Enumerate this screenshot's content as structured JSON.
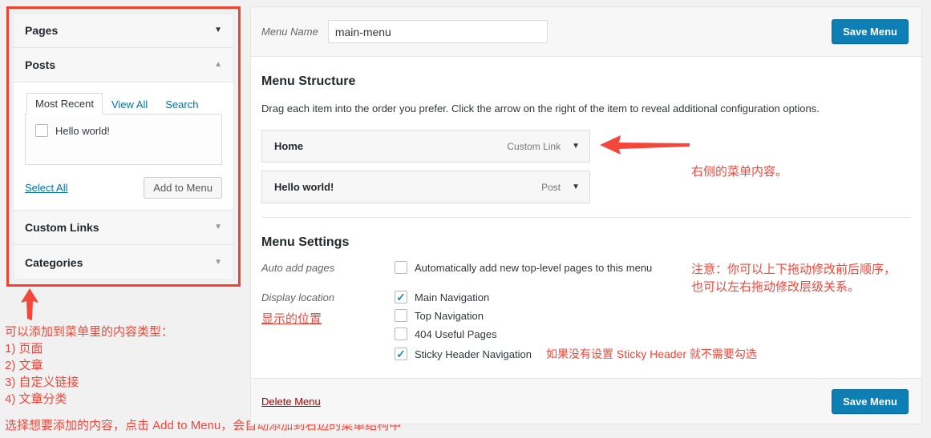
{
  "sidebar": {
    "panels": [
      {
        "label": "Pages",
        "icon": "chevron-down-icon",
        "glyph": "▼",
        "expanded": false
      },
      {
        "label": "Posts",
        "icon": "chevron-up-icon",
        "glyph": "▲",
        "expanded": true
      },
      {
        "label": "Custom Links",
        "icon": "chevron-down-icon",
        "glyph": "▼",
        "expanded": false
      },
      {
        "label": "Categories",
        "icon": "chevron-down-icon",
        "glyph": "▼",
        "expanded": false
      }
    ],
    "posts_panel": {
      "tabs": [
        {
          "label": "Most Recent",
          "active": true
        },
        {
          "label": "View All",
          "active": false
        },
        {
          "label": "Search",
          "active": false
        }
      ],
      "items": [
        {
          "label": "Hello world!",
          "checked": false
        }
      ],
      "select_all_label": "Select All",
      "add_to_menu_label": "Add to Menu"
    }
  },
  "main": {
    "menu_name_label": "Menu Name",
    "menu_name_value": "main-menu",
    "save_menu_label": "Save Menu",
    "structure_title": "Menu Structure",
    "structure_desc": "Drag each item into the order you prefer. Click the arrow on the right of the item to reveal additional configuration options.",
    "menu_items": [
      {
        "title": "Home",
        "type": "Custom Link",
        "glyph": "▼"
      },
      {
        "title": "Hello world!",
        "type": "Post",
        "glyph": "▼"
      }
    ],
    "settings_title": "Menu Settings",
    "auto_add_label": "Auto add pages",
    "auto_add_option": "Automatically add new top-level pages to this menu",
    "auto_add_checked": false,
    "display_location_label": "Display location",
    "display_location_note": "显示的位置",
    "locations": [
      {
        "label": "Main Navigation",
        "checked": true,
        "note": ""
      },
      {
        "label": "Top Navigation",
        "checked": false,
        "note": ""
      },
      {
        "label": "404 Useful Pages",
        "checked": false,
        "note": ""
      },
      {
        "label": "Sticky Header Navigation",
        "checked": true,
        "note": "如果没有设置 Sticky Header 就不需要勾选"
      }
    ],
    "delete_menu_label": "Delete Menu",
    "save_menu_label_bottom": "Save Menu"
  },
  "annotations": {
    "left_block": "可以添加到菜单里的内容类型：\n1) 页面\n2) 文章\n3) 自定义链接\n4) 文章分类",
    "bottom_line": "选择想要添加的内容，点击 Add to Menu，会自动添加到右边的菜单结构中",
    "right_line1": "右侧的菜单内容。",
    "right_line2": "注意：你可以上下拖动修改前后顺序，\n也可以左右拖动修改层级关系。"
  },
  "colors": {
    "accent_blue": "#0d7fb5",
    "annotation_red": "#f4463a",
    "highlight_border": "#f4402f",
    "delete_link": "#a00",
    "link_blue": "#0073aa"
  }
}
